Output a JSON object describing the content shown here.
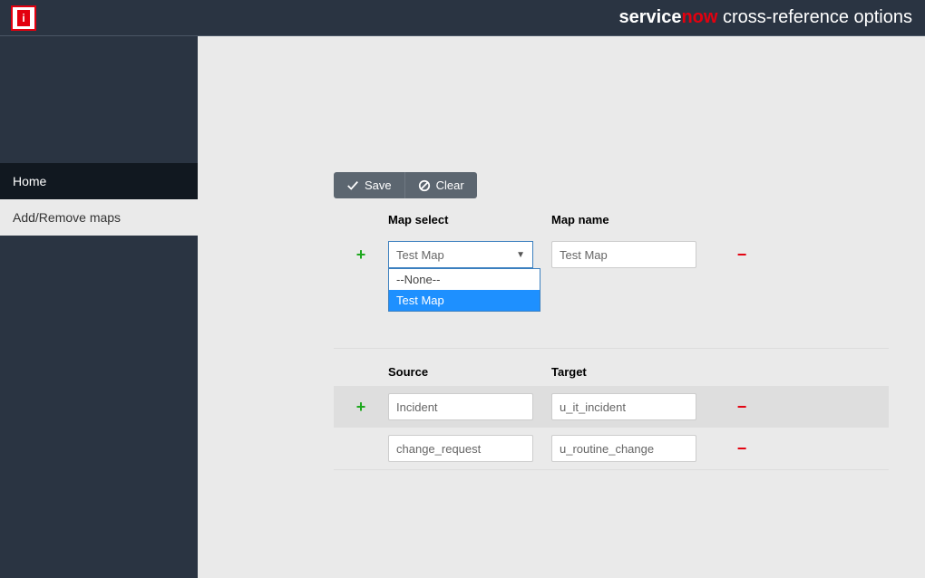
{
  "header": {
    "logo_letter": "i",
    "title_service": "service",
    "title_now": "now",
    "title_suffix": " cross-reference options"
  },
  "sidebar": {
    "items": [
      {
        "label": "Home",
        "active": true
      },
      {
        "label": "Add/Remove maps",
        "light": true
      }
    ]
  },
  "toolbar": {
    "save_label": "Save",
    "clear_label": "Clear"
  },
  "map_section": {
    "col_a": "Map select",
    "col_b": "Map name",
    "select_value": "Test Map",
    "options": [
      {
        "label": "--None--",
        "selected": false
      },
      {
        "label": "Test Map",
        "selected": true
      }
    ],
    "name_value": "Test Map"
  },
  "mapping_section": {
    "col_a": "Source",
    "col_b": "Target",
    "rows": [
      {
        "source": "Incident",
        "target": "u_it_incident",
        "highlight": true,
        "show_add": true
      },
      {
        "source": "change_request",
        "target": "u_routine_change",
        "highlight": false,
        "show_add": false
      }
    ]
  }
}
